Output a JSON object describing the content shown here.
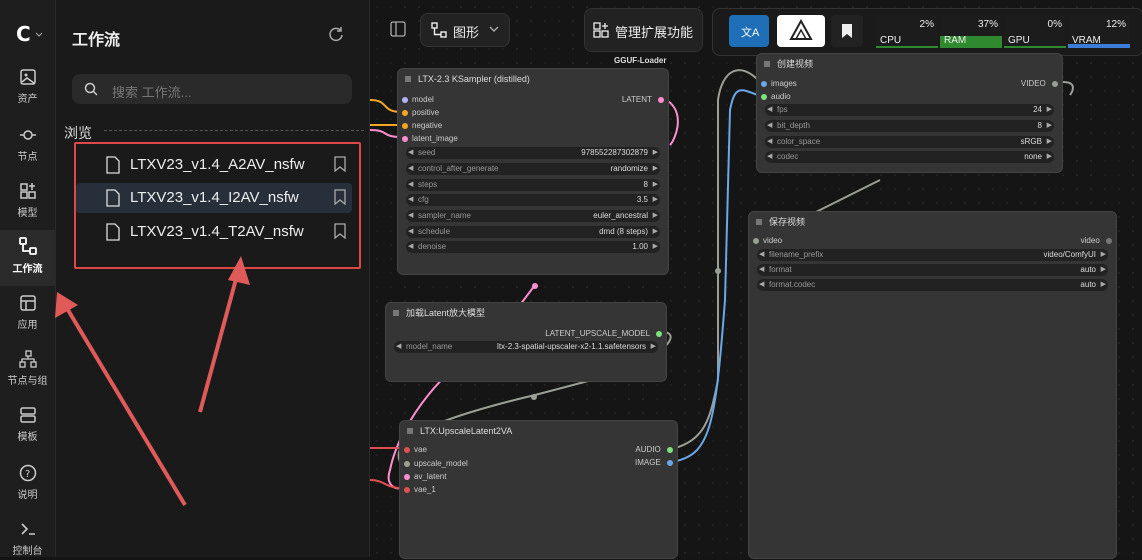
{
  "rail": {
    "items": [
      {
        "label": "资产",
        "icon": "image-icon"
      },
      {
        "label": "节点",
        "icon": "node-icon"
      },
      {
        "label": "模型",
        "icon": "model-icon"
      },
      {
        "label": "工作流",
        "icon": "workflow-icon"
      },
      {
        "label": "应用",
        "icon": "app-icon"
      },
      {
        "label": "节点与组",
        "icon": "node-group-icon"
      },
      {
        "label": "模板",
        "icon": "template-icon"
      },
      {
        "label": "说明",
        "icon": "help-icon"
      },
      {
        "label": "控制台",
        "icon": "console-icon"
      }
    ]
  },
  "panel": {
    "title": "工作流",
    "search_placeholder": "搜索 工作流...",
    "browse_label": "浏览",
    "workflows": [
      "LTXV23_v1.4_A2AV_nsfw",
      "LTXV23_v1.4_I2AV_nsfw",
      "LTXV23_v1.4_T2AV_nsfw"
    ]
  },
  "toolbar": {
    "graph_label": "图形",
    "manage_ext_label": "管理扩展功能",
    "gguf_label": "GGUF-Loader",
    "stats": [
      {
        "label": "CPU",
        "value": "2%",
        "fill": 0.02
      },
      {
        "label": "RAM",
        "value": "37%",
        "fill": 0.37
      },
      {
        "label": "GPU",
        "value": "0%",
        "fill": 0.0
      },
      {
        "label": "VRAM",
        "value": "12%",
        "fill": 0.12
      }
    ]
  },
  "nodes": {
    "ksampler": {
      "title": "LTX-2.3 KSampler (distilled)",
      "inputs": [
        "model",
        "positive",
        "negative",
        "latent_image"
      ],
      "output": "LATENT",
      "widgets": [
        {
          "label": "seed",
          "value": "978552287302879"
        },
        {
          "label": "control_after_generate",
          "value": "randomize"
        },
        {
          "label": "steps",
          "value": "8"
        },
        {
          "label": "cfg",
          "value": "3.5"
        },
        {
          "label": "sampler_name",
          "value": "euler_ancestral"
        },
        {
          "label": "schedule",
          "value": "dmd (8 steps)"
        },
        {
          "label": "denoise",
          "value": "1.00"
        }
      ]
    },
    "latent_upscale_loader": {
      "title": "加载Latent放大模型",
      "output": "LATENT_UPSCALE_MODEL",
      "widgets": [
        {
          "label": "model_name",
          "value": "ltx-2.3-spatial-upscaler-x2-1.1.safetensors"
        }
      ]
    },
    "upscale": {
      "title": "LTX:UpscaleLatent2VA",
      "inputs": [
        "vae",
        "upscale_model",
        "av_latent",
        "vae_1"
      ],
      "outputs": [
        "AUDIO",
        "IMAGE"
      ]
    },
    "create_video": {
      "title": "创建视频",
      "inputs": [
        "images",
        "audio"
      ],
      "output": "VIDEO",
      "widgets": [
        {
          "label": "fps",
          "value": "24"
        },
        {
          "label": "bit_depth",
          "value": "8"
        },
        {
          "label": "color_space",
          "value": "sRGB"
        },
        {
          "label": "codec",
          "value": "none"
        }
      ]
    },
    "save_video": {
      "title": "保存视频",
      "input": "video",
      "output": "video",
      "widgets": [
        {
          "label": "filename_prefix",
          "value": "video/ComfyUI"
        },
        {
          "label": "format",
          "value": "auto"
        },
        {
          "label": "format.codec",
          "value": "auto"
        }
      ]
    }
  },
  "colors": {
    "highlight": "#e04848",
    "accent": "#1e6fb8"
  }
}
